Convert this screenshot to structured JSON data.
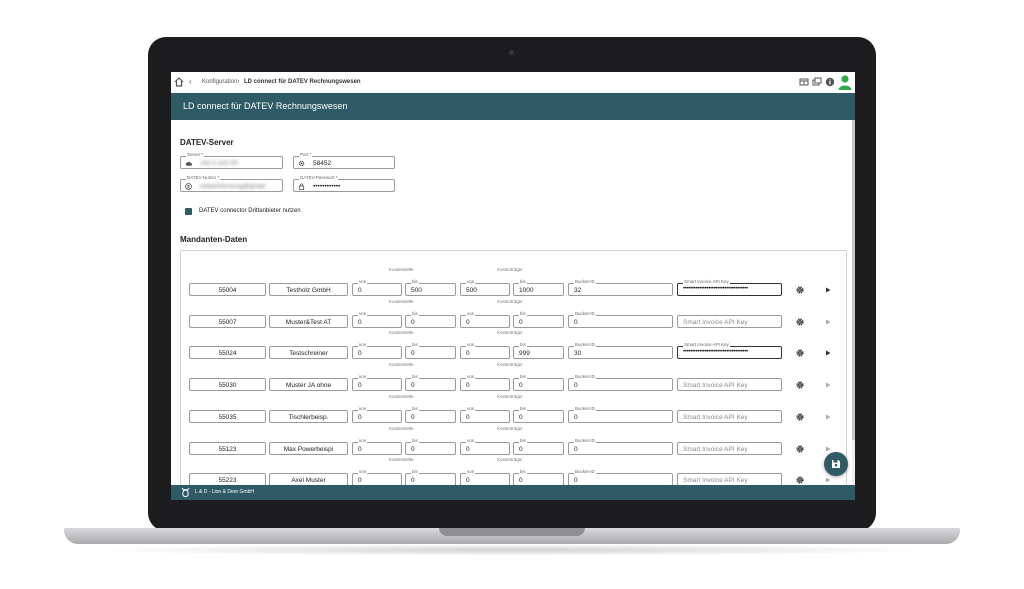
{
  "breadcrumb": {
    "parent": "Konfiguration",
    "current": "LD connect für DATEV Rechnungswesen"
  },
  "title": "LD connect für DATEV Rechnungswesen",
  "server_section": {
    "title": "DATEV-Server",
    "server": {
      "label": "Server",
      "value": "192.0.102.90"
    },
    "port": {
      "label": "Port",
      "value": "58452"
    },
    "user": {
      "label": "DATEV-Nutzer",
      "value": "ludwichtestung@gmail"
    },
    "password": {
      "label": "DATEV-Passwort",
      "value": "••••••••••••"
    }
  },
  "checkbox": {
    "label": "DATEV connector Drittanbieter nutzen",
    "checked": true
  },
  "clients_section": {
    "title": "Mandanten-Daten",
    "labels": {
      "kostenstelle": "Kostenstelle",
      "kostentraeger": "Kostenträger",
      "von": "von",
      "bis": "bis",
      "bucket": "Bucket-ID",
      "key": "Smart Invoice API Key"
    },
    "rows": [
      {
        "nr": "55004",
        "name": "Testholz GmbH",
        "ks_von": "0",
        "ks_bis": "500",
        "kt_von": "500",
        "kt_bis": "1000",
        "bucket": "32",
        "key": "••••••••••••••••••••••••••••••••••••",
        "has_key": true,
        "active": true
      },
      {
        "nr": "55007",
        "name": "Muster&Test AT",
        "ks_von": "0",
        "ks_bis": "0",
        "kt_von": "0",
        "kt_bis": "0",
        "bucket": "0",
        "key": "Smart Invoice API Key",
        "has_key": false,
        "active": false
      },
      {
        "nr": "55024",
        "name": "Testschreiner",
        "ks_von": "0",
        "ks_bis": "0",
        "kt_von": "0",
        "kt_bis": "999",
        "bucket": "30",
        "key": "••••••••••••••••••••••••••••••••••••",
        "has_key": true,
        "active": true
      },
      {
        "nr": "55030",
        "name": "Muster JA ohne",
        "ks_von": "0",
        "ks_bis": "0",
        "kt_von": "0",
        "kt_bis": "0",
        "bucket": "0",
        "key": "Smart Invoice API Key",
        "has_key": false,
        "active": false
      },
      {
        "nr": "55035",
        "name": "Tischlerbeisp.",
        "ks_von": "0",
        "ks_bis": "0",
        "kt_von": "0",
        "kt_bis": "0",
        "bucket": "0",
        "key": "Smart Invoice API Key",
        "has_key": false,
        "active": false
      },
      {
        "nr": "55123",
        "name": "Max Powerbeispi",
        "ks_von": "0",
        "ks_bis": "0",
        "kt_von": "0",
        "kt_bis": "0",
        "bucket": "0",
        "key": "Smart Invoice API Key",
        "has_key": false,
        "active": false
      },
      {
        "nr": "55223",
        "name": "Axel Muster",
        "ks_von": "0",
        "ks_bis": "0",
        "kt_von": "0",
        "kt_bis": "0",
        "bucket": "0",
        "key": "Smart Invoice API Key",
        "has_key": false,
        "active": false
      }
    ]
  },
  "footer": {
    "company": "L & D - Lion & Deer GmbH"
  },
  "colors": {
    "primary": "#2f5b66",
    "laptop": "#1d1d1f"
  }
}
